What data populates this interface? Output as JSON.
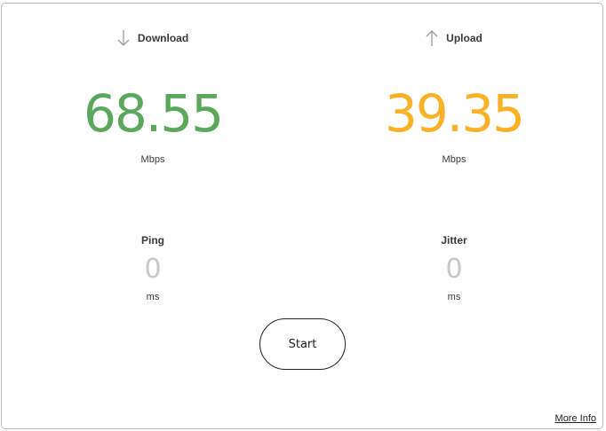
{
  "download": {
    "icon": "arrow-down-icon",
    "label": "Download",
    "value": "68.55",
    "unit": "Mbps",
    "color": "#5aa85a"
  },
  "upload": {
    "icon": "arrow-up-icon",
    "label": "Upload",
    "value": "39.35",
    "unit": "Mbps",
    "color": "#fbb125"
  },
  "ping": {
    "label": "Ping",
    "value": "0",
    "unit": "ms"
  },
  "jitter": {
    "label": "Jitter",
    "value": "0",
    "unit": "ms"
  },
  "start_label": "Start",
  "more_info_label": "More Info"
}
